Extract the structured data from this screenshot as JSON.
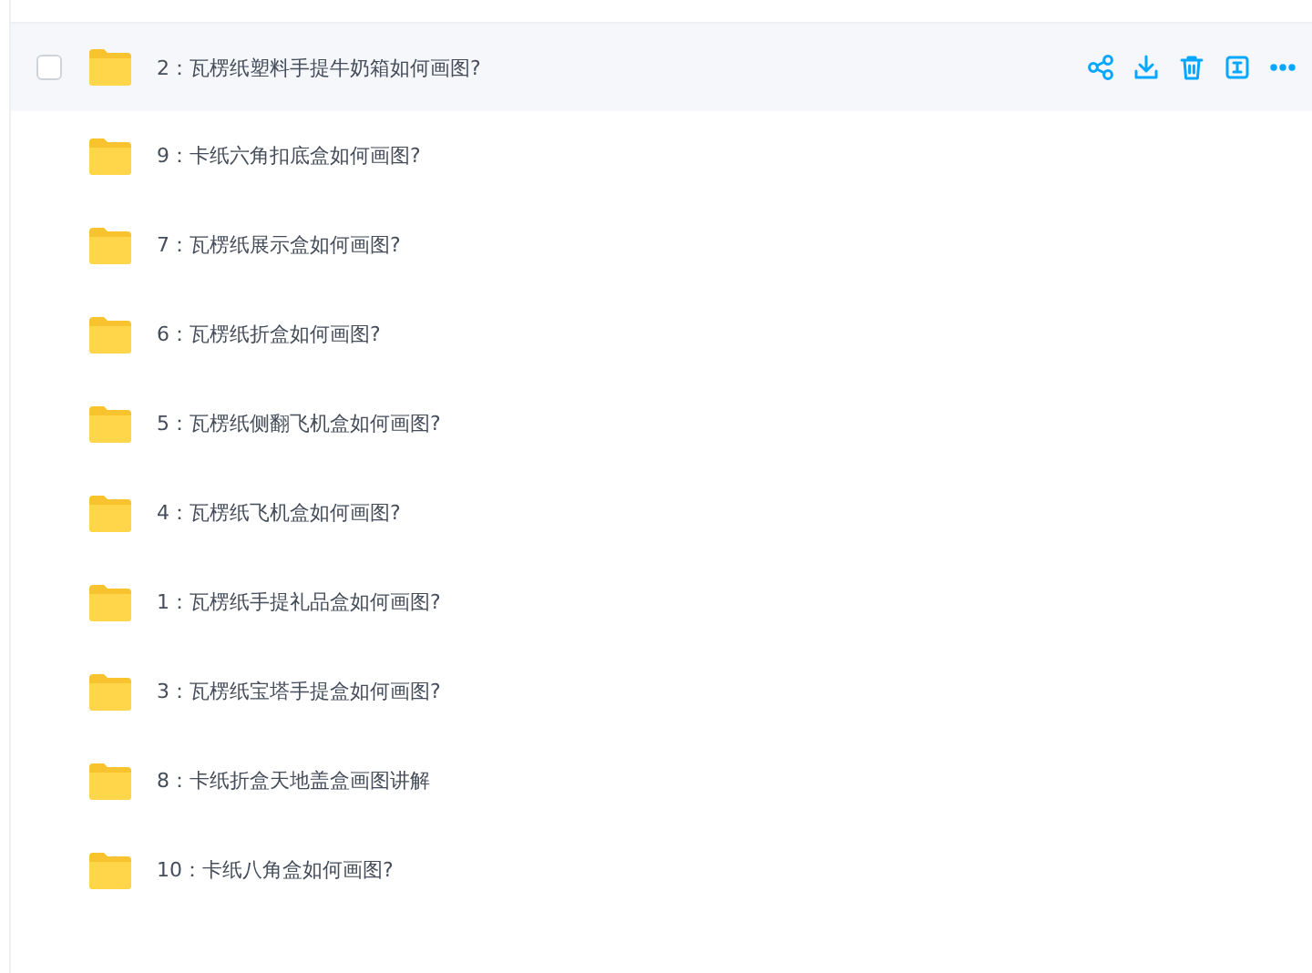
{
  "rows": [
    {
      "name": "2：瓦楞纸塑料手提牛奶箱如何画图?",
      "hovered": true,
      "checkbox": {
        "checked": false
      },
      "actions": [
        {
          "kind": "share"
        },
        {
          "kind": "download"
        },
        {
          "kind": "delete"
        },
        {
          "kind": "rename"
        },
        {
          "kind": "more"
        }
      ]
    },
    {
      "name": "9：卡纸六角扣底盒如何画图?",
      "hovered": false
    },
    {
      "name": "7：瓦楞纸展示盒如何画图?",
      "hovered": false
    },
    {
      "name": "6：瓦楞纸折盒如何画图?",
      "hovered": false
    },
    {
      "name": "5：瓦楞纸侧翻飞机盒如何画图?",
      "hovered": false
    },
    {
      "name": "4：瓦楞纸飞机盒如何画图?",
      "hovered": false
    },
    {
      "name": "1：瓦楞纸手提礼品盒如何画图?",
      "hovered": false
    },
    {
      "name": "3：瓦楞纸宝塔手提盒如何画图?",
      "hovered": false
    },
    {
      "name": "8：卡纸折盒天地盖盒画图讲解",
      "hovered": false
    },
    {
      "name": "10：卡纸八角盒如何画图?",
      "hovered": false
    }
  ]
}
